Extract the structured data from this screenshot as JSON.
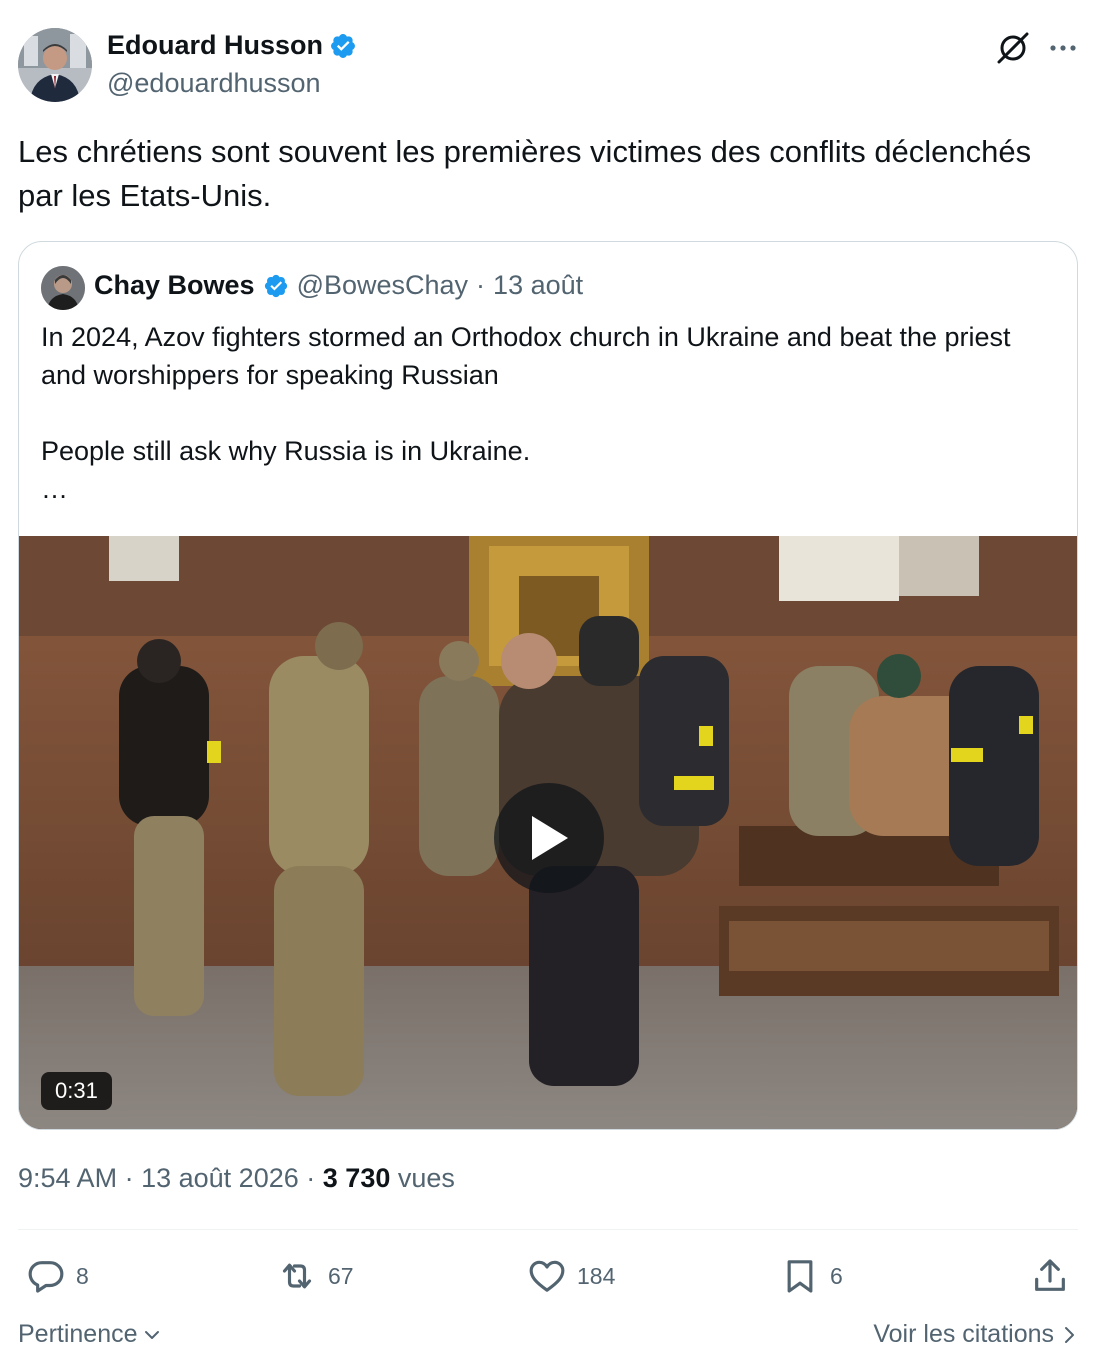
{
  "author": {
    "name": "Edouard Husson",
    "handle": "@edouardhusson"
  },
  "tweet": {
    "text": "Les chrétiens sont souvent les premières victimes des conflits déclenchés par les Etats-Unis."
  },
  "quote": {
    "name": "Chay Bowes",
    "handle": "@BowesChay",
    "separator": "·",
    "date": "13 août",
    "text": "In 2024, Azov fighters stormed an Orthodox church in Ukraine and beat the priest and worshippers for speaking Russian\n\nPeople still ask why Russia is in Ukraine.\n…",
    "media": {
      "duration": "0:31"
    }
  },
  "meta": {
    "time": "9:54 AM",
    "separator": "·",
    "date": "13 août 2026",
    "views_count": "3 730",
    "views_label": "vues"
  },
  "actions": {
    "replies": "8",
    "reposts": "67",
    "likes": "184",
    "bookmarks": "6"
  },
  "footer": {
    "sort_label": "Pertinence",
    "quotes_label": "Voir les citations"
  },
  "colors": {
    "verified": "#1d9bf0",
    "text_primary": "#0f1419",
    "text_secondary": "#536471",
    "border": "#cfd9de"
  }
}
